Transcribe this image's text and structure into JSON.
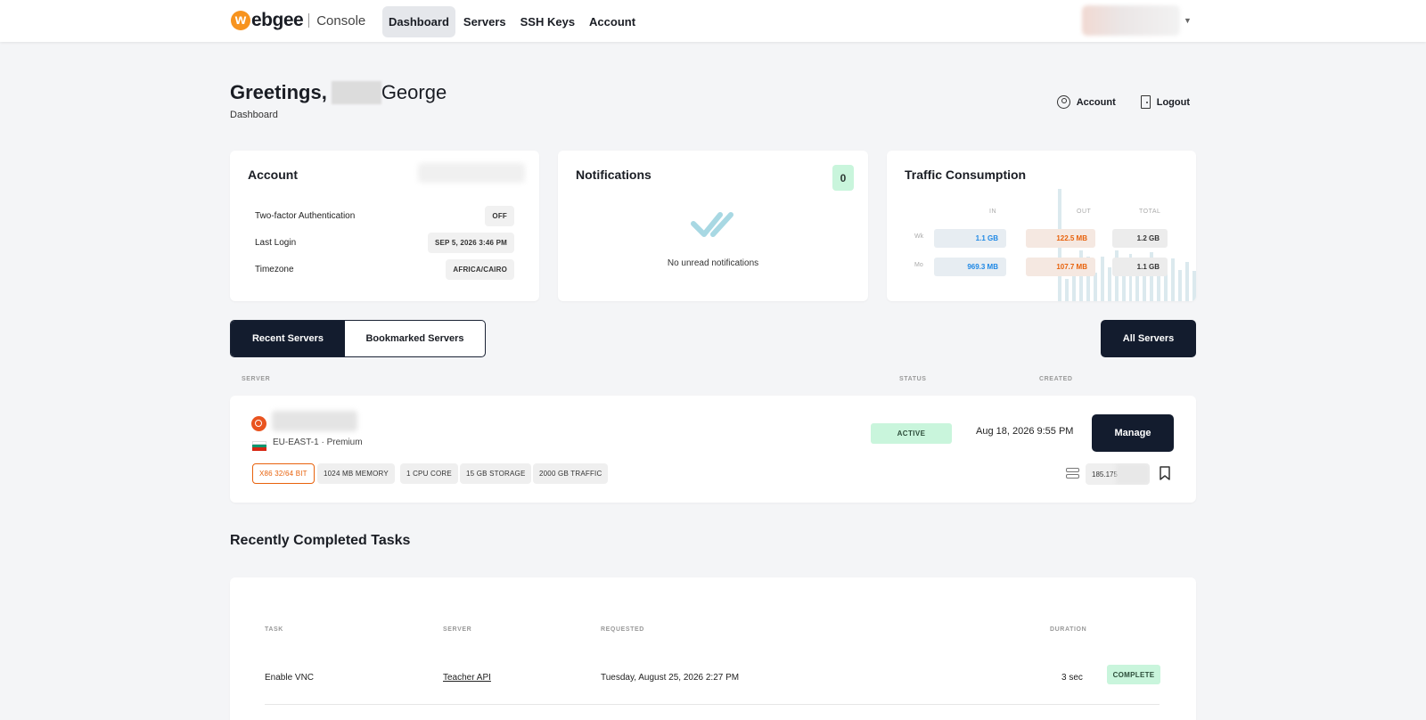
{
  "nav": {
    "logo_letter": "w",
    "logo_text": "ebgee",
    "console_label": "Console",
    "items": [
      {
        "label": "Dashboard",
        "active": true
      },
      {
        "label": "Servers",
        "active": false
      },
      {
        "label": "SSH Keys",
        "active": false
      },
      {
        "label": "Account",
        "active": false
      }
    ]
  },
  "header": {
    "greeting": "Greetings,",
    "name": "George",
    "subtitle": "Dashboard",
    "account_link": "Account",
    "logout_link": "Logout"
  },
  "account_card": {
    "title": "Account",
    "rows": [
      {
        "label": "Two-factor Authentication",
        "value": "OFF"
      },
      {
        "label": "Last Login",
        "value": "SEP 5, 2026 3:46 PM"
      },
      {
        "label": "Timezone",
        "value": "AFRICA/CAIRO"
      }
    ]
  },
  "notifications_card": {
    "title": "Notifications",
    "count": "0",
    "empty_text": "No unread notifications"
  },
  "traffic_card": {
    "title": "Traffic Consumption",
    "headers": {
      "in": "IN",
      "out": "OUT",
      "total": "TOTAL"
    },
    "rows": [
      {
        "label": "Wk",
        "in": "1.1 GB",
        "out": "122.5 MB",
        "total": "1.2 GB"
      },
      {
        "label": "Mo",
        "in": "969.3 MB",
        "out": "107.7 MB",
        "total": "1.1 GB"
      }
    ],
    "bar_levels": [
      1.0,
      0.2,
      0.3,
      0.45,
      0.4,
      0.25,
      0.4,
      0.3,
      0.45,
      0.35,
      0.42,
      0.38,
      0.25,
      0.44,
      0.35,
      0.3,
      0.38,
      0.28,
      0.35,
      0.27
    ]
  },
  "servers": {
    "tabs": [
      {
        "label": "Recent Servers",
        "active": true
      },
      {
        "label": "Bookmarked Servers",
        "active": false
      }
    ],
    "all_servers_label": "All Servers",
    "columns": {
      "server": "SERVER",
      "status": "STATUS",
      "created": "CREATED"
    },
    "item": {
      "region": "EU-EAST-1 · Premium",
      "specs": [
        "X86 32/64 BIT",
        "1024 MB MEMORY",
        "1 CPU CORE",
        "15 GB STORAGE",
        "2000 GB TRAFFIC"
      ],
      "status": "ACTIVE",
      "created": "Aug 18, 2026 9:55 PM",
      "manage_label": "Manage",
      "ip_prefix": "185.175"
    }
  },
  "tasks": {
    "title": "Recently Completed Tasks",
    "columns": {
      "task": "TASK",
      "server": "SERVER",
      "requested": "REQUESTED",
      "duration": "DURATION"
    },
    "rows": [
      {
        "task": "Enable VNC",
        "server": "Teacher API",
        "requested": "Tuesday, August 25, 2026 2:27 PM",
        "duration": "3 sec",
        "status": "COMPLETE"
      }
    ]
  },
  "colors": {
    "dark_navy": "#131c2e",
    "success_bg": "#c9f5dc",
    "in_blue": "#1e88e5",
    "out_orange": "#e8620c",
    "ubuntu_orange": "#e95420"
  }
}
